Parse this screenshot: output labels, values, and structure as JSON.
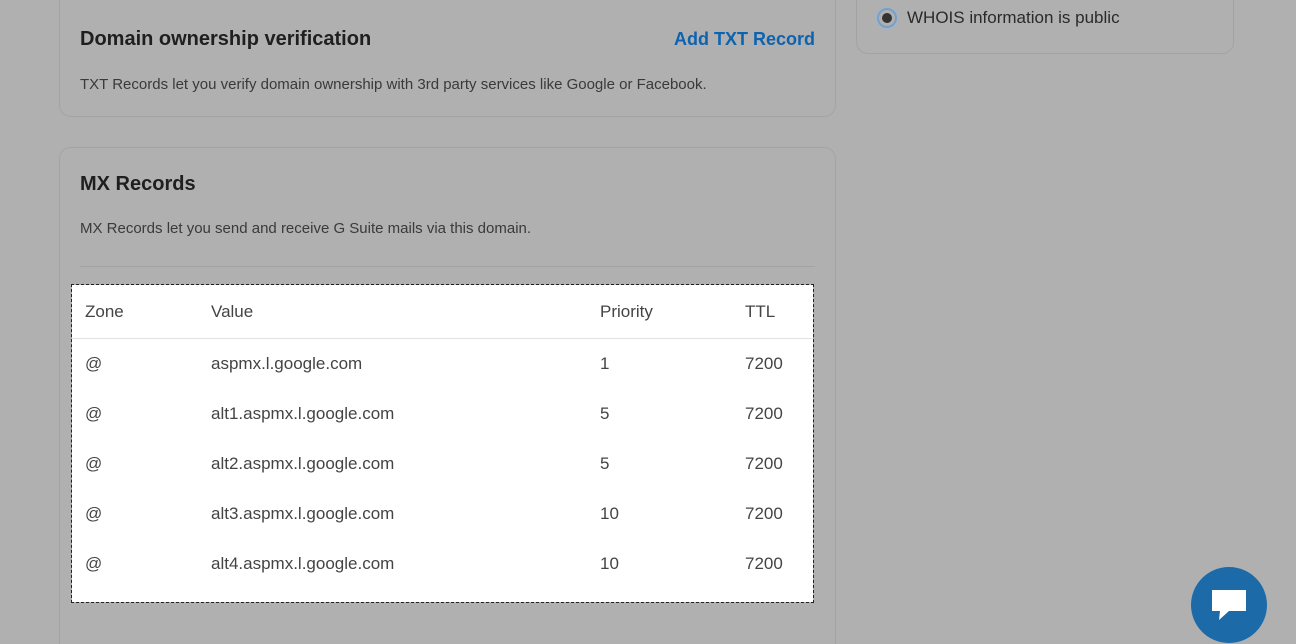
{
  "txt_card": {
    "title": "Domain ownership verification",
    "add_link": "Add TXT Record",
    "description": "TXT Records let you verify domain ownership with 3rd party services like Google or Facebook."
  },
  "mx_card": {
    "title": "MX Records",
    "description": "MX Records let you send and receive G Suite mails via this domain.",
    "table": {
      "headers": {
        "zone": "Zone",
        "value": "Value",
        "priority": "Priority",
        "ttl": "TTL"
      },
      "rows": [
        {
          "zone": "@",
          "value": "aspmx.l.google.com",
          "priority": "1",
          "ttl": "7200"
        },
        {
          "zone": "@",
          "value": "alt1.aspmx.l.google.com",
          "priority": "5",
          "ttl": "7200"
        },
        {
          "zone": "@",
          "value": "alt2.aspmx.l.google.com",
          "priority": "5",
          "ttl": "7200"
        },
        {
          "zone": "@",
          "value": "alt3.aspmx.l.google.com",
          "priority": "10",
          "ttl": "7200"
        },
        {
          "zone": "@",
          "value": "alt4.aspmx.l.google.com",
          "priority": "10",
          "ttl": "7200"
        }
      ]
    }
  },
  "whois_card": {
    "option_label": "WHOIS information is public",
    "selected": true
  },
  "chat": {
    "icon": "chat-bubble-icon"
  },
  "colors": {
    "link": "#0d63b0",
    "chat_button": "#1c6aa8",
    "overlay_background": "#b0b0b0"
  }
}
